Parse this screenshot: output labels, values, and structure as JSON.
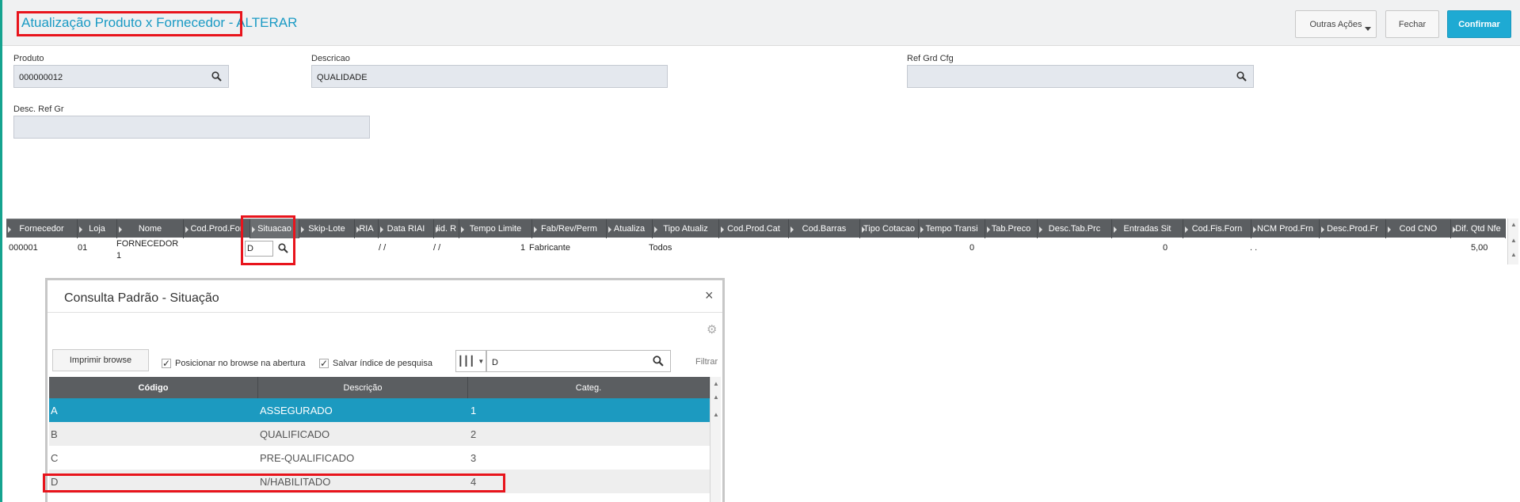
{
  "header": {
    "title": "Atualização Produto x Fornecedor",
    "subtitle": " - ALTERAR",
    "buttons": {
      "outras": "Outras Ações",
      "fechar": "Fechar",
      "confirmar": "Confirmar"
    }
  },
  "form": {
    "produto": {
      "label": "Produto",
      "value": "000000012"
    },
    "descricao": {
      "label": "Descricao",
      "value": "QUALIDADE"
    },
    "ref_grd": {
      "label": "Ref Grd Cfg",
      "value": ""
    },
    "desc_ref": {
      "label": "Desc. Ref Gr",
      "value": ""
    }
  },
  "grid": {
    "columns": [
      "Fornecedor",
      "Loja",
      "Nome",
      "Cod.Prod.For",
      "Situacao",
      "Skip-Lote",
      "RIA",
      "Data RIAI",
      "lid. R",
      "Tempo Limite",
      "Fab/Rev/Perm",
      "Atualiza",
      "Tipo Atualiz",
      "Cod.Prod.Cat",
      "Cod.Barras",
      "Tipo Cotacao",
      "Tempo Transi",
      "Tab.Preco",
      "Desc.Tab.Prc",
      "Entradas Sit",
      "Cod.Fis.Forn",
      "NCM Prod.Frn",
      "Desc.Prod.Fr",
      "Cod CNO",
      "Dif. Qtd Nfe"
    ],
    "row": {
      "fornecedor": "000001",
      "loja": "01",
      "nome_l1": "FORNECEDOR",
      "nome_l2": "1",
      "situacao": "D",
      "data_riai": "/ /",
      "valid": "/ /",
      "tempo_limite": "1",
      "fab": "Fabricante",
      "tipo_atualiz": "Todos",
      "tempo_transi": "0",
      "entradas": "0",
      "ncm": ". .",
      "dif_qtd": "5,00"
    }
  },
  "modal": {
    "title": "Consulta Padrão - Situação",
    "close": "×",
    "imprimir": "Imprimir browse",
    "chk1": "Posicionar no browse na abertura",
    "chk2": "Salvar índice de pesquisa",
    "search_value": "D",
    "filtrar": "Filtrar",
    "columns": [
      "Código",
      "Descrição",
      "Categ."
    ],
    "rows": [
      {
        "codigo": "A",
        "descricao": "ASSEGURADO",
        "categ": "1"
      },
      {
        "codigo": "B",
        "descricao": "QUALIFICADO",
        "categ": "2"
      },
      {
        "codigo": "C",
        "descricao": "PRE-QUALIFICADO",
        "categ": "3"
      },
      {
        "codigo": "D",
        "descricao": "N/HABILITADO",
        "categ": "4"
      }
    ]
  },
  "colors": {
    "accent": "#1eaad3",
    "title": "#1a9ac4",
    "highlight": "#e8141c",
    "grid_header": "#5b5e61",
    "selected_row": "#1c9ac0"
  }
}
